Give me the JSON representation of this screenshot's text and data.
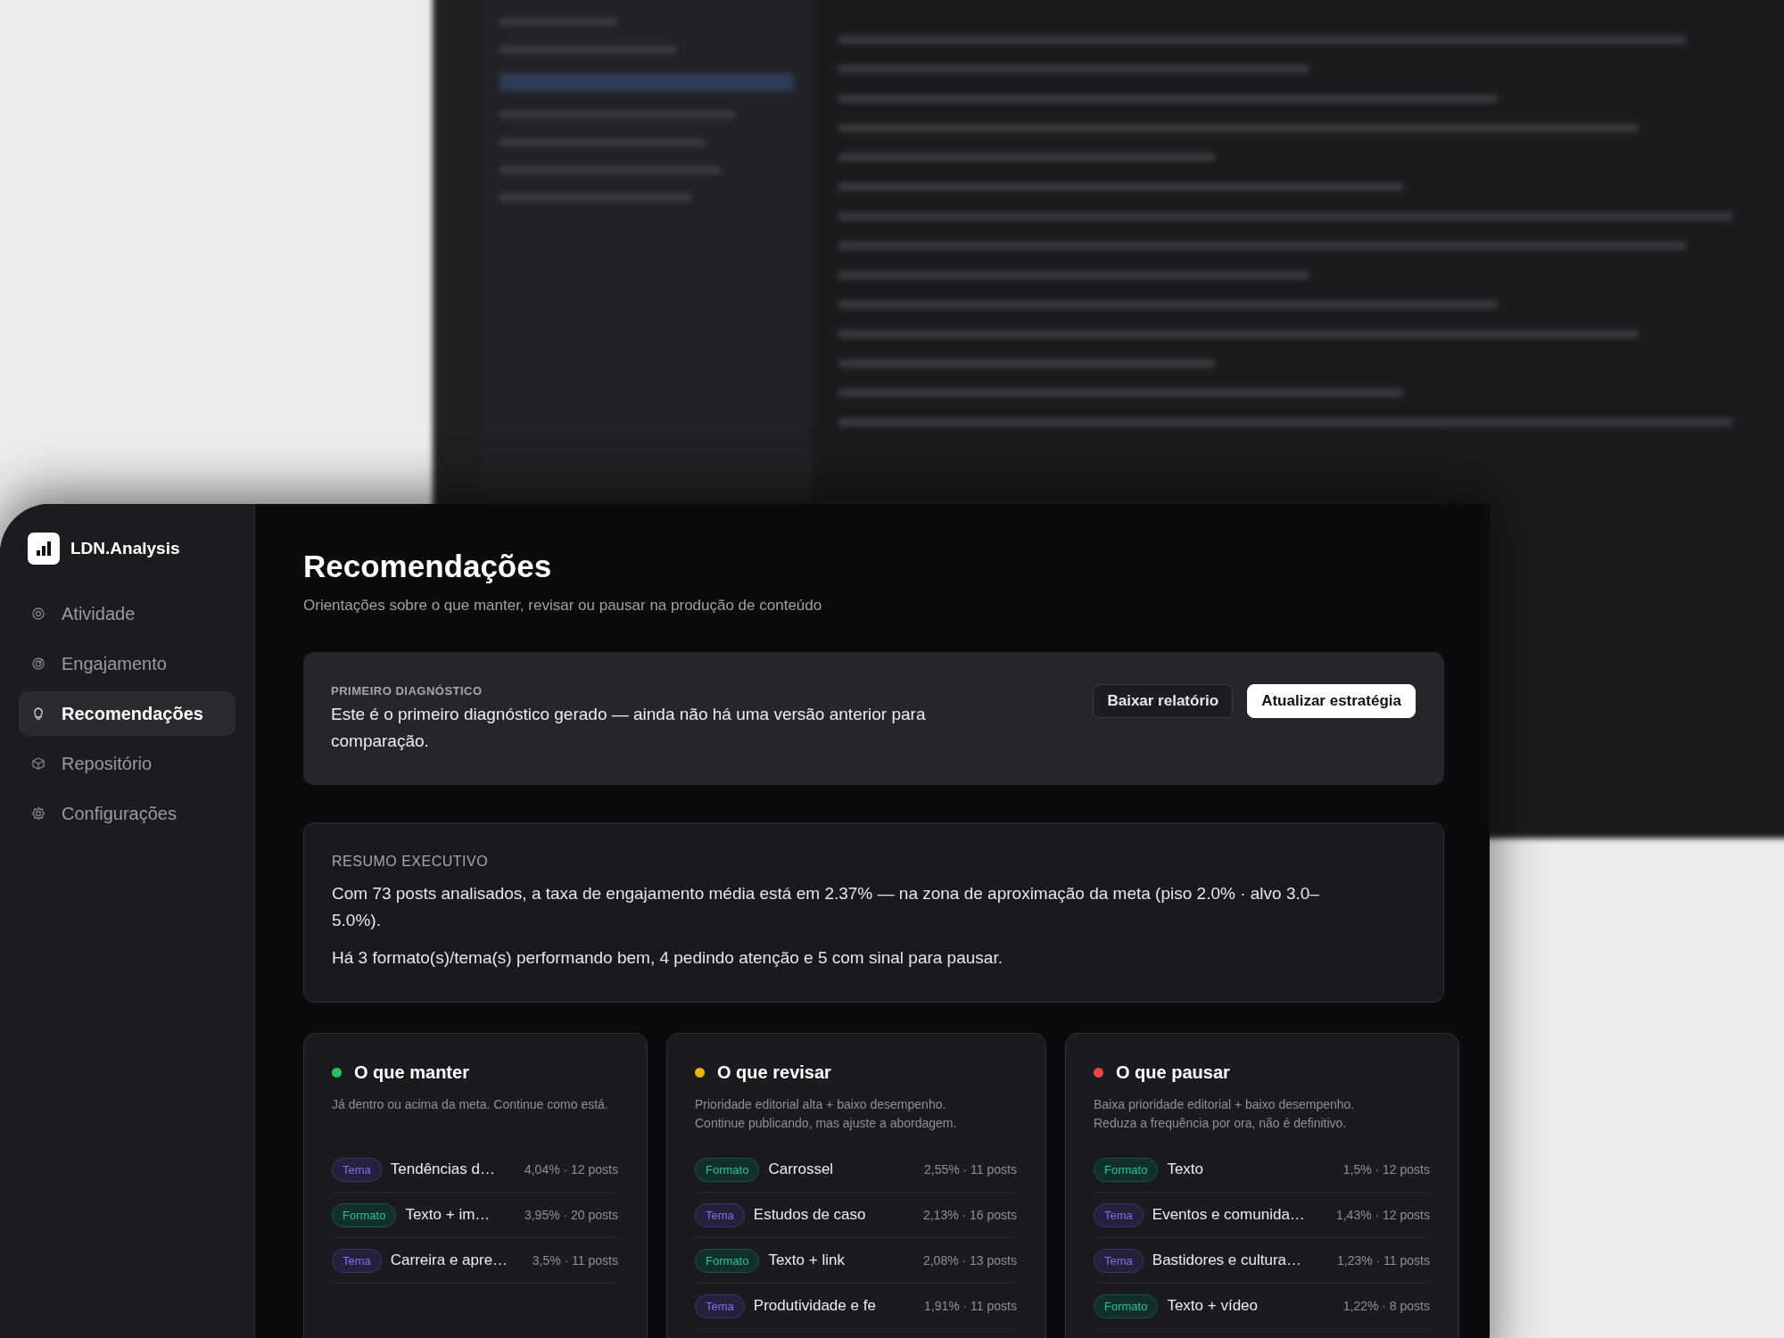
{
  "sidebar": {
    "brand": "LDN.Analysis",
    "items": [
      {
        "label": "Atividade",
        "selected": false
      },
      {
        "label": "Engajamento",
        "selected": false
      },
      {
        "label": "Recomendações",
        "selected": true
      },
      {
        "label": "Repositório",
        "selected": false
      },
      {
        "label": "Configurações",
        "selected": false
      }
    ]
  },
  "page": {
    "title": "Recomendações",
    "subtitle": "Orientações sobre o que manter, revisar ou pausar na produção de conteúdo"
  },
  "diagnostic": {
    "label": "PRIMEIRO DIAGNÓSTICO",
    "text": "Este é o primeiro diagnóstico gerado — ainda não há uma versão anterior para comparação.",
    "buttons": [
      {
        "label": "Baixar relatório",
        "kind": "secondary"
      },
      {
        "label": "Atualizar estratégia",
        "kind": "primary"
      }
    ]
  },
  "summary": {
    "label": "RESUMO EXECUTIVO",
    "paragraphs": [
      "Com 73 posts analisados, a taxa de engajamento média está em 2.37% — na zona de aproximação da meta (piso 2.0% · alvo 3.0–5.0%).",
      "Há 3 formato(s)/tema(s) performando bem, 4 pedindo atenção e 5 com sinal para pausar."
    ]
  },
  "columns": [
    {
      "title": "O que manter",
      "color": "#22c55e",
      "description": "Já dentro ou acima da meta. Continue como está.",
      "rows": [
        {
          "tag": {
            "kind": "tema",
            "label": "Tema"
          },
          "name": "Tendências d…",
          "stats": "4,04% · 12 posts"
        },
        {
          "tag": {
            "kind": "formato",
            "label": "Formato"
          },
          "name": "Texto + im…",
          "stats": "3,95% · 20 posts"
        },
        {
          "tag": {
            "kind": "tema",
            "label": "Tema"
          },
          "name": "Carreira e apre…",
          "stats": "3,5% · 11 posts"
        }
      ]
    },
    {
      "title": "O que revisar",
      "color": "#eab308",
      "description": "Prioridade editorial alta + baixo desempenho. Continue publicando, mas ajuste a abordagem.",
      "rows": [
        {
          "tag": {
            "kind": "formato",
            "label": "Formato"
          },
          "name": "Carrossel",
          "stats": "2,55% · 11 posts"
        },
        {
          "tag": {
            "kind": "tema",
            "label": "Tema"
          },
          "name": "Estudos de caso",
          "stats": "2,13% · 16 posts"
        },
        {
          "tag": {
            "kind": "formato",
            "label": "Formato"
          },
          "name": "Texto + link",
          "stats": "2,08% · 13 posts"
        },
        {
          "tag": {
            "kind": "tema",
            "label": "Tema"
          },
          "name": "Produtividade e fe",
          "stats": "1,91% · 11 posts"
        }
      ]
    },
    {
      "title": "O que pausar",
      "color": "#ef4444",
      "description": "Baixa prioridade editorial + baixo desempenho. Reduza a frequência por ora, não é definitivo.",
      "rows": [
        {
          "tag": {
            "kind": "formato",
            "label": "Formato"
          },
          "name": "Texto",
          "stats": "1,5% · 12 posts"
        },
        {
          "tag": {
            "kind": "tema",
            "label": "Tema"
          },
          "name": "Eventos e comunida…",
          "stats": "1,43% · 12 posts"
        },
        {
          "tag": {
            "kind": "tema",
            "label": "Tema"
          },
          "name": "Bastidores e cultura…",
          "stats": "1,23% · 11 posts"
        },
        {
          "tag": {
            "kind": "formato",
            "label": "Formato"
          },
          "name": "Texto + vídeo",
          "stats": "1,22% · 8 posts"
        }
      ]
    }
  ]
}
